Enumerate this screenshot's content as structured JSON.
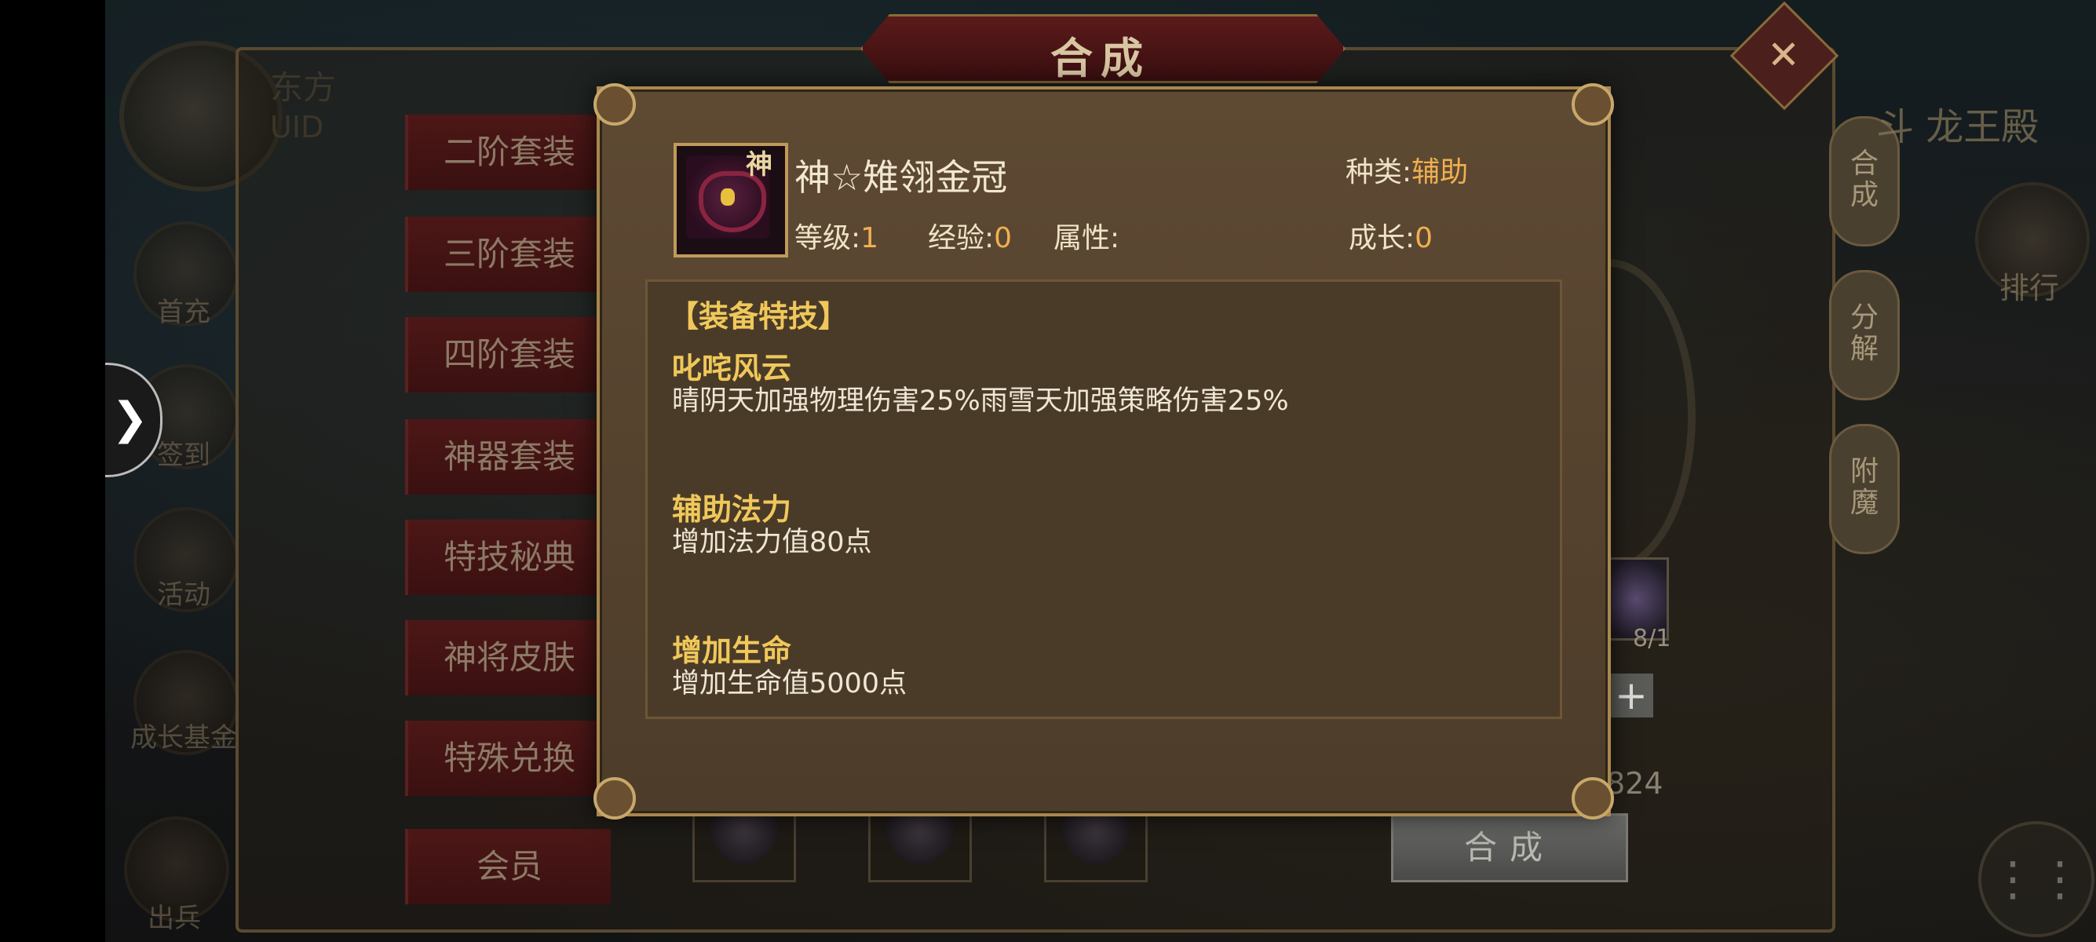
{
  "screen_title": "合成",
  "player": {
    "name_partial": "东方",
    "uid_label": "UID"
  },
  "side_menu": [
    "首充",
    "签到",
    "活动",
    "成长基金",
    "出兵"
  ],
  "tabs": [
    "二阶套装",
    "三阶套装",
    "四阶套装",
    "神器套装",
    "特技秘典",
    "神将皮肤",
    "特殊兑换",
    "会员"
  ],
  "right_tabs": [
    "合成",
    "分解",
    "附魔"
  ],
  "right_panel": {
    "title": "斗 龙王殿",
    "rank_label": "排行"
  },
  "material": {
    "count": "8/1",
    "cost": "824",
    "synth_button": "合成"
  },
  "modal": {
    "item_name": "神☆雉翎金冠",
    "badge": "神",
    "kind_label": "种类:",
    "kind_value": "辅助",
    "level_label": "等级:",
    "level_value": "1",
    "exp_label": "经验:",
    "exp_value": "0",
    "attr_label": "属性:",
    "growth_label": "成长:",
    "growth_value": "0",
    "skills_header": "【装备特技】",
    "skills": [
      {
        "title": "叱咤风云",
        "desc": "晴阴天加强物理伤害25%雨雪天加强策略伤害25%"
      },
      {
        "title": "辅助法力",
        "desc": "增加法力值80点"
      },
      {
        "title": "增加生命",
        "desc": "增加生命值5000点"
      }
    ]
  },
  "colors": {
    "highlight_gold": "#f0c85a",
    "value_orange": "#f0b050",
    "tab_red": "#4d1717"
  }
}
